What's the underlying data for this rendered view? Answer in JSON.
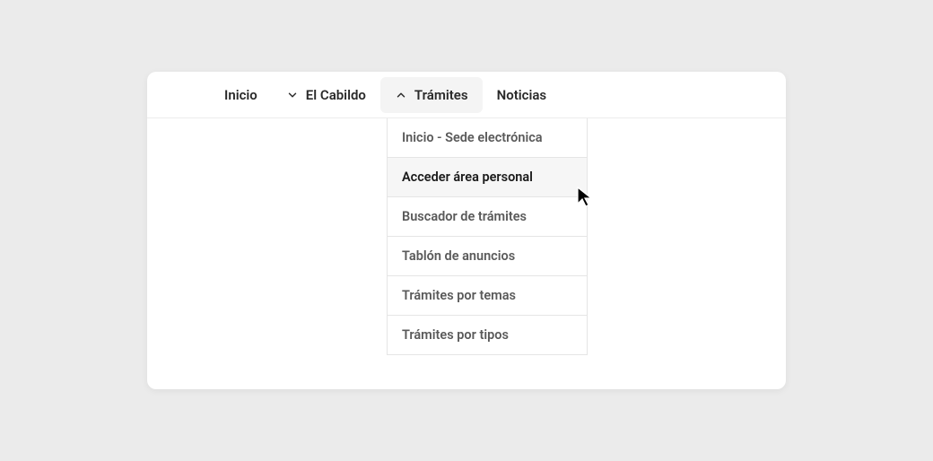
{
  "nav": {
    "items": [
      {
        "label": "Inicio",
        "hasChevron": false
      },
      {
        "label": "El Cabildo",
        "hasChevron": true,
        "chevronDir": "down"
      },
      {
        "label": "Trámites",
        "hasChevron": true,
        "chevronDir": "up",
        "active": true
      },
      {
        "label": "Noticias",
        "hasChevron": false
      }
    ]
  },
  "dropdown": {
    "items": [
      {
        "label": "Inicio - Sede electrónica"
      },
      {
        "label": "Acceder área personal",
        "hovered": true
      },
      {
        "label": "Buscador de trámites"
      },
      {
        "label": "Tablón de anuncios"
      },
      {
        "label": "Trámites por temas"
      },
      {
        "label": "Trámites por tipos"
      }
    ]
  }
}
